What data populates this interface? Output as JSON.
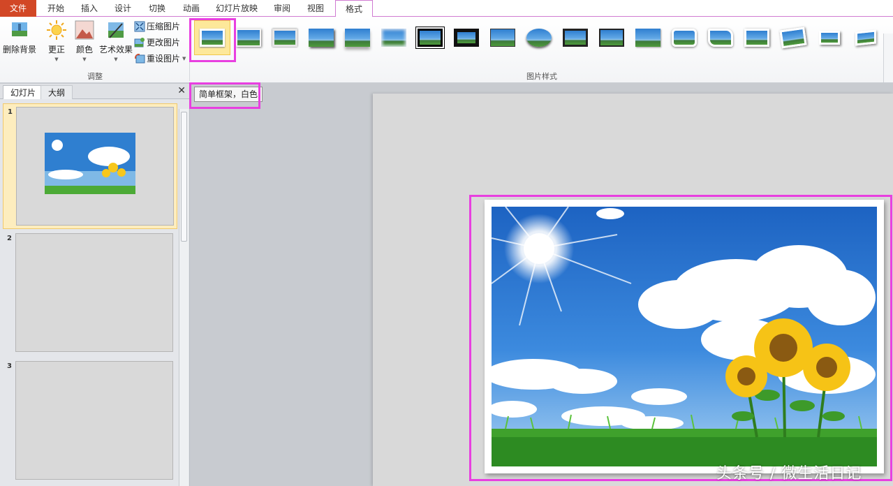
{
  "tabs": {
    "file": "文件",
    "items": [
      "开始",
      "插入",
      "设计",
      "切换",
      "动画",
      "幻灯片放映",
      "审阅",
      "视图"
    ],
    "active": "格式"
  },
  "ribbon": {
    "adjust": {
      "remove_bg": "删除背景",
      "corrections": "更正",
      "color": "颜色",
      "artistic": "艺术效果",
      "compress": "压缩图片",
      "change": "更改图片",
      "reset": "重设图片",
      "group_label": "调整"
    },
    "styles": {
      "group_label": "图片样式",
      "selected_style_tooltip": "简单框架，白色"
    }
  },
  "panel": {
    "tab_slides": "幻灯片",
    "tab_outline": "大纲",
    "slides": [
      {
        "number": "1"
      },
      {
        "number": "2"
      },
      {
        "number": "3"
      }
    ]
  },
  "watermark": "头条号 / 微生活日记",
  "colors": {
    "file_tab": "#d24726",
    "highlight": "#e83fe0",
    "selected_style": "#fde89a"
  }
}
